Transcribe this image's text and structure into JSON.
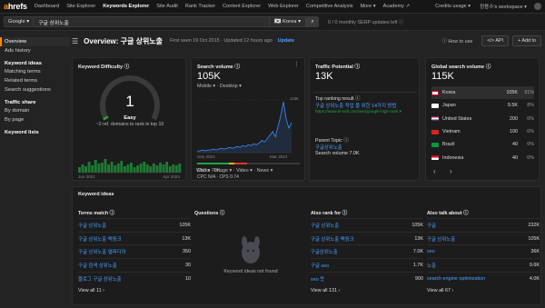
{
  "nav": {
    "logo_a": "a",
    "logo_rest": "hrefs",
    "items": [
      "Dashboard",
      "Site Explorer",
      "Keywords Explorer",
      "Site Audit",
      "Rank Tracker",
      "Content Explorer",
      "Web Explorer",
      "Competitive Analysis",
      "More ▾",
      "Academy ↗"
    ],
    "credits": "Credits usage ▾",
    "workspace": "정용수's workspace ▾"
  },
  "search": {
    "engine": "Google ▾",
    "keyword": "구글 상위노출",
    "country": "🇰🇷 Korea ▾",
    "usage": "0 / 0 monthly SERP updates left ⓘ"
  },
  "sidebar": {
    "top": [
      "Overview",
      "Ads history"
    ],
    "sections": [
      {
        "head": "Keyword ideas",
        "items": [
          "Matching terms",
          "Related terms",
          "Search suggestions"
        ]
      },
      {
        "head": "Traffic share",
        "items": [
          "By domain",
          "By page"
        ]
      },
      {
        "head": "Keyword lists",
        "items": []
      }
    ]
  },
  "header": {
    "title": "Overview: 구글 상위노출",
    "first_seen": "First seen 19 Oct 2015 · Updated 12 hours ago",
    "update": "Update",
    "how_to": "ⓘ How to use",
    "api": "</> API",
    "add_to": "+ Add to"
  },
  "difficulty": {
    "title": "Keyword Difficulty ⓘ",
    "value": "1",
    "label": "Easy",
    "note": "~2 ref. domains to rank in top 10",
    "gauge_fraction": 0.01,
    "x_start": "Jun 2021",
    "x_end": "Apr 2024"
  },
  "volume": {
    "title": "Search volume ⓘ",
    "value": "105K",
    "devices": "Mobile ▾ · Desktop ▾",
    "chart_max": "115K",
    "x_start": "Sep 2015",
    "x_end": "Mar 2024",
    "clicks": "Clicks 78K",
    "cpc": "CPC N/A · CPS 0.74",
    "serp": "Web ▾ · Image ▾ · Video ▾ · News ▾"
  },
  "traffic": {
    "title": "Traffic Potential ⓘ",
    "value": "13K",
    "top_page_label": "Top ranking result ⓘ",
    "top_page_title": "구글 상위노출 작업 을 위한 14가지 방법",
    "top_page_url": "https://www.ls-soft.com/seo/google-high-rank ▾",
    "parent_label": "Parent Topic ⓘ",
    "parent_topic": "구글상위노출",
    "parent_volume": "Search volume 7.0K"
  },
  "global": {
    "title": "Global search volume ⓘ",
    "value": "115K",
    "rows": [
      {
        "country": "Korea",
        "volume": "105K",
        "pct": "91%"
      },
      {
        "country": "Japan",
        "volume": "9.5K",
        "pct": "8%"
      },
      {
        "country": "United States",
        "volume": "200",
        "pct": "0%"
      },
      {
        "country": "Vietnam",
        "volume": "100",
        "pct": "0%"
      },
      {
        "country": "Brazil",
        "volume": "40",
        "pct": "0%"
      },
      {
        "country": "Indonesia",
        "volume": "40",
        "pct": "0%"
      }
    ],
    "prev": "‹",
    "next": "›"
  },
  "ideas": {
    "title": "Keyword ideas",
    "columns": [
      {
        "head": "Terms match ⓘ",
        "rows": [
          [
            "구글 상위노출",
            "105K"
          ],
          [
            "구글 상위노출 백링크",
            "13K"
          ],
          [
            "구글 상위노출 엘피디아",
            "350"
          ],
          [
            "구글 검색 상위노출",
            "30"
          ],
          [
            "블로그 구글 상위노출",
            "10"
          ]
        ],
        "view": "View all 11 ›"
      },
      {
        "head": "Questions ⓘ",
        "rows": [],
        "empty": "Keyword ideas not found",
        "view": ""
      },
      {
        "head": "Also rank for ⓘ",
        "rows": [
          [
            "구글 상위노출",
            "105K"
          ],
          [
            "구글 상위노출 백링크",
            "13K"
          ],
          [
            "구글상위노출",
            "7.0K"
          ],
          [
            "구글 seo",
            "1.7K"
          ],
          [
            "seo 뜻",
            "900"
          ]
        ],
        "view": "View all 131 ›"
      },
      {
        "head": "Also talk about ⓘ",
        "rows": [
          [
            "구글",
            "232K"
          ],
          [
            "구글 상위노출",
            "105K"
          ],
          [
            "seo",
            "36K"
          ],
          [
            "노출",
            "9.6K"
          ],
          [
            "search engine optimization",
            "4.0K"
          ]
        ],
        "view": "View all 67 ›"
      }
    ]
  },
  "colors": {
    "accent": "#ff8800",
    "link": "#4aa0ff",
    "chart_line": "#3d8bff",
    "kd_green": "#25a244"
  }
}
